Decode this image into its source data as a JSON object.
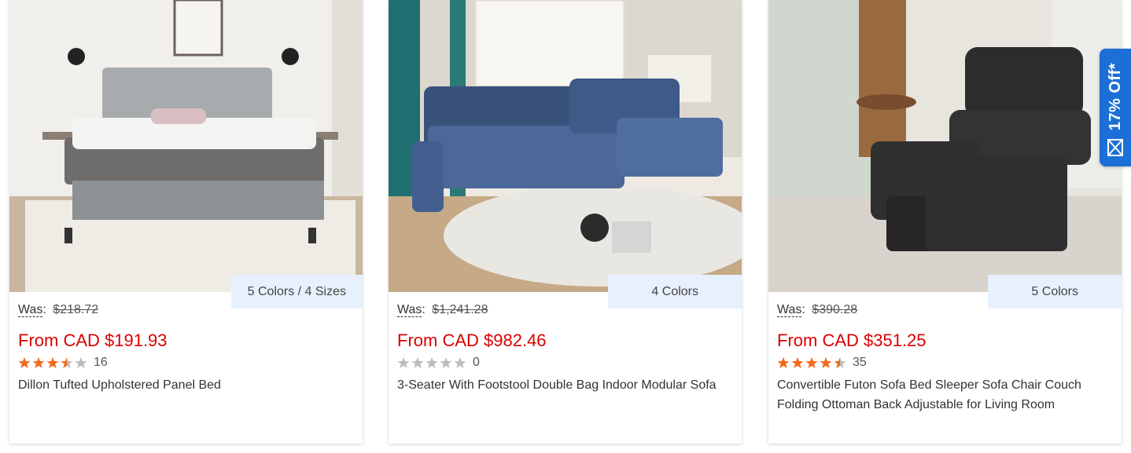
{
  "colors": {
    "sale_price": "#dd0000",
    "badge_bg": "#e7f1fd",
    "star_filled": "#f26b1d",
    "star_empty": "#bdbdbd",
    "promo_bg": "#1c6fd6"
  },
  "promo_tab": {
    "label": "17% Off*",
    "icon": "envelope-icon"
  },
  "products": [
    {
      "image": "panel-bed-photo",
      "variant_badge": "5 Colors / 4 Sizes",
      "was_label": "Was",
      "was_price": "$218.72",
      "price": "From CAD $191.93",
      "rating": 3.5,
      "review_count": "16",
      "title": "Dillon Tufted Upholstered Panel Bed"
    },
    {
      "image": "modular-sofa-photo",
      "variant_badge": "4 Colors",
      "was_label": "Was",
      "was_price": "$1,241.28",
      "price": "From CAD $982.46",
      "rating": 0,
      "review_count": "0",
      "title": "3-Seater With Footstool Double Bag Indoor Modular Sofa"
    },
    {
      "image": "futon-sofa-bed-photo",
      "variant_badge": "5 Colors",
      "was_label": "Was",
      "was_price": "$390.28",
      "price": "From CAD $351.25",
      "rating": 4.5,
      "review_count": "35",
      "title": "Convertible Futon Sofa Bed Sleeper Sofa Chair Couch Folding Ottoman Back Adjustable for Living Room"
    }
  ]
}
